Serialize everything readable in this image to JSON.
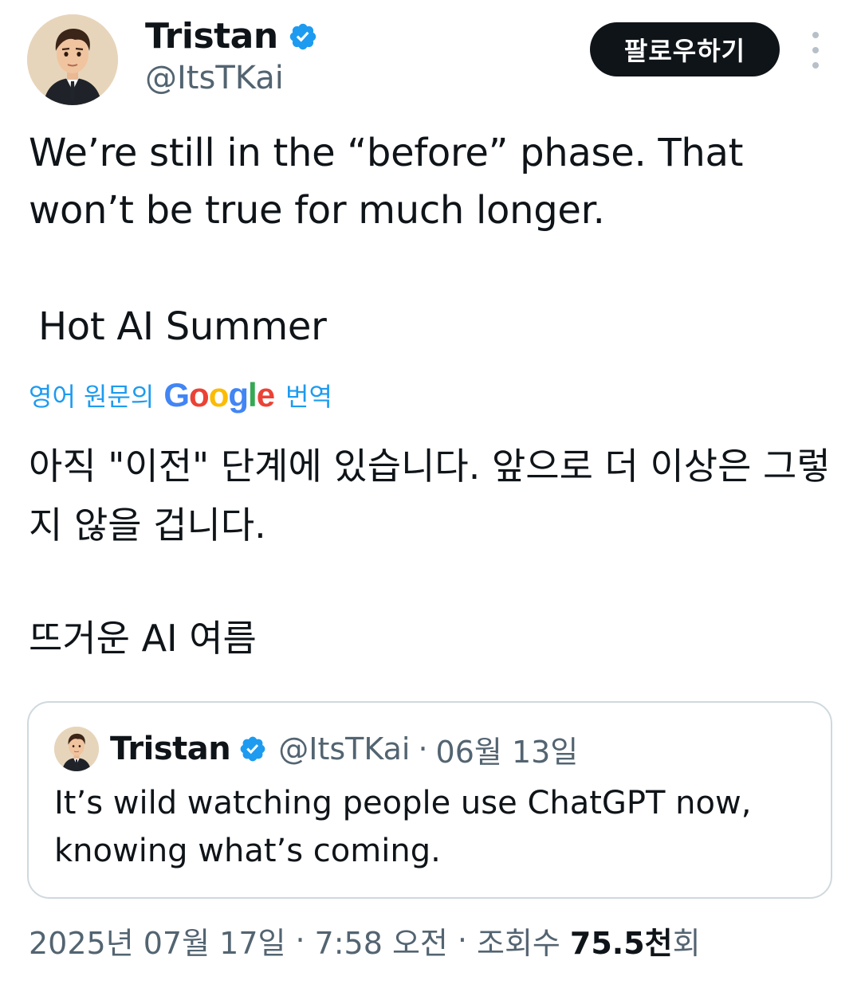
{
  "author": {
    "display_name": "Tristan",
    "handle": "@ItsTKai",
    "avatar_icon": "avatar-illustrated-man-in-suit",
    "verified_icon": "verified-badge-icon"
  },
  "actions": {
    "follow_label": "팔로우하기",
    "more_icon": "more-vertical-icon"
  },
  "tweet": {
    "text": "We’re still in the “before” phase. That won’t be true for much longer.",
    "text_2": "Hot AI Summer"
  },
  "translation": {
    "prefix": "영어 원문의",
    "logo_letters": [
      "G",
      "o",
      "o",
      "g",
      "l",
      "e"
    ],
    "suffix": "번역",
    "text": "아직 \"이전\" 단계에 있습니다. 앞으로 더 이상은 그렇지 않을 겁니다.",
    "text_2": "뜨거운 AI 여름"
  },
  "quoted_tweet": {
    "display_name": "Tristan",
    "handle": "@ItsTKai",
    "separator": "·",
    "date": "06월 13일",
    "text": "It’s wild watching people use ChatGPT now, knowing what’s coming."
  },
  "meta": {
    "date": "2025년 07월 17일",
    "separator": "·",
    "time": "7:58 오전",
    "views_label": "조회수",
    "views_count": "75.5천",
    "views_unit": "회"
  },
  "colors": {
    "text": "#0f1419",
    "secondary": "#536471",
    "link": "#1d9bf0",
    "verified": "#1d9bf0",
    "button_bg": "#0f1419",
    "border": "#cfd9de"
  }
}
